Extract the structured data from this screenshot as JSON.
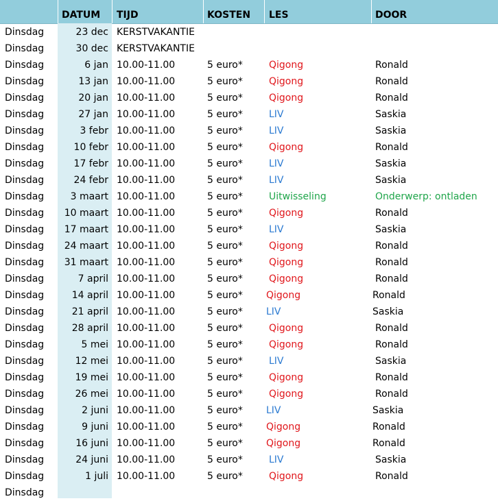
{
  "headers": {
    "col0": "",
    "datum": "DATUM",
    "tijd": "TIJD",
    "kosten": "KOSTEN",
    "les": "LES",
    "door": "DOOR"
  },
  "colors": {
    "header_bg": "#92cddc",
    "datum_bg": "#daeef3",
    "qigong": "#e0161b",
    "liv": "#2b7ad1",
    "uitwisseling": "#1fa54a"
  },
  "rows": [
    {
      "day": "Dinsdag",
      "date": "23 dec",
      "time": "KERSTVAKANTIE",
      "cost": "",
      "les": "",
      "les_type": "",
      "door": "",
      "door_type": ""
    },
    {
      "day": "Dinsdag",
      "date": "30 dec",
      "time": "KERSTVAKANTIE",
      "cost": "",
      "les": "",
      "les_type": "",
      "door": "",
      "door_type": ""
    },
    {
      "day": "Dinsdag",
      "date": "6 jan",
      "time": "10.00-11.00",
      "cost": "5 euro*",
      "les": "Qigong",
      "les_type": "qigong",
      "door": "Ronald",
      "door_type": ""
    },
    {
      "day": "Dinsdag",
      "date": "13 jan",
      "time": "10.00-11.00",
      "cost": "5 euro*",
      "les": "Qigong",
      "les_type": "qigong",
      "door": "Ronald",
      "door_type": ""
    },
    {
      "day": "Dinsdag",
      "date": "20 jan",
      "time": "10.00-11.00",
      "cost": "5 euro*",
      "les": "Qigong",
      "les_type": "qigong",
      "door": "Ronald",
      "door_type": ""
    },
    {
      "day": "Dinsdag",
      "date": "27 jan",
      "time": "10.00-11.00",
      "cost": "5 euro*",
      "les": "LIV",
      "les_type": "liv",
      "door": "Saskia",
      "door_type": ""
    },
    {
      "day": "Dinsdag",
      "date": "3 febr",
      "time": "10.00-11.00",
      "cost": "5 euro*",
      "les": "LIV",
      "les_type": "liv",
      "door": "Saskia",
      "door_type": ""
    },
    {
      "day": "Dinsdag",
      "date": "10 febr",
      "time": "10.00-11.00",
      "cost": "5 euro*",
      "les": "Qigong",
      "les_type": "qigong",
      "door": "Ronald",
      "door_type": ""
    },
    {
      "day": "Dinsdag",
      "date": "17 febr",
      "time": "10.00-11.00",
      "cost": "5 euro*",
      "les": "LIV",
      "les_type": "liv",
      "door": "Saskia",
      "door_type": ""
    },
    {
      "day": "Dinsdag",
      "date": "24 febr",
      "time": "10.00-11.00",
      "cost": "5 euro*",
      "les": "LIV",
      "les_type": "liv",
      "door": "Saskia",
      "door_type": ""
    },
    {
      "day": "Dinsdag",
      "date": "3 maart",
      "time": "10.00-11.00",
      "cost": "5 euro*",
      "les": "Uitwisseling",
      "les_type": "uitwisseling",
      "door": "Onderwerp:  ontladen",
      "door_type": "uitwisseling"
    },
    {
      "day": "Dinsdag",
      "date": "10 maart",
      "time": "10.00-11.00",
      "cost": "5 euro*",
      "les": "Qigong",
      "les_type": "qigong",
      "door": "Ronald",
      "door_type": ""
    },
    {
      "day": "Dinsdag",
      "date": "17 maart",
      "time": "10.00-11.00",
      "cost": "5 euro*",
      "les": "LIV",
      "les_type": "liv",
      "door": "Saskia",
      "door_type": ""
    },
    {
      "day": "Dinsdag",
      "date": "24 maart",
      "time": "10.00-11.00",
      "cost": "5 euro*",
      "les": "Qigong",
      "les_type": "qigong",
      "door": "Ronald",
      "door_type": ""
    },
    {
      "day": "Dinsdag",
      "date": "31 maart",
      "time": "10.00-11.00",
      "cost": "5 euro*",
      "les": "Qigong",
      "les_type": "qigong",
      "door": "Ronald",
      "door_type": ""
    },
    {
      "day": "Dinsdag",
      "date": "7 april",
      "time": "10.00-11.00",
      "cost": "5 euro*",
      "les": "Qigong",
      "les_type": "qigong",
      "door": "Ronald",
      "door_type": ""
    },
    {
      "day": "Dinsdag",
      "date": "14 april",
      "time": "10.00-11.00",
      "cost": "5 euro*",
      "les": "Qigong",
      "les_type": "qigong",
      "door": "Ronald",
      "door_type": ""
    },
    {
      "day": "Dinsdag",
      "date": "21 april",
      "time": "10.00-11.00",
      "cost": "5 euro*",
      "les": "LIV",
      "les_type": "liv",
      "door": "Saskia",
      "door_type": ""
    },
    {
      "day": "Dinsdag",
      "date": "28 april",
      "time": "10.00-11.00",
      "cost": "5 euro*",
      "les": "Qigong",
      "les_type": "qigong",
      "door": "Ronald",
      "door_type": ""
    },
    {
      "day": "Dinsdag",
      "date": "5 mei",
      "time": "10.00-11.00",
      "cost": "5 euro*",
      "les": "Qigong",
      "les_type": "qigong",
      "door": "Ronald",
      "door_type": ""
    },
    {
      "day": "Dinsdag",
      "date": "12 mei",
      "time": "10.00-11.00",
      "cost": "5 euro*",
      "les": "LIV",
      "les_type": "liv",
      "door": "Saskia",
      "door_type": ""
    },
    {
      "day": "Dinsdag",
      "date": "19 mei",
      "time": "10.00-11.00",
      "cost": "5 euro*",
      "les": "Qigong",
      "les_type": "qigong",
      "door": "Ronald",
      "door_type": ""
    },
    {
      "day": "Dinsdag",
      "date": "26 mei",
      "time": "10.00-11.00",
      "cost": "5 euro*",
      "les": "Qigong",
      "les_type": "qigong",
      "door": "Ronald",
      "door_type": ""
    },
    {
      "day": "Dinsdag",
      "date": "2 juni",
      "time": "10.00-11.00",
      "cost": "5 euro*",
      "les": "LIV",
      "les_type": "liv",
      "door": "Saskia",
      "door_type": ""
    },
    {
      "day": "Dinsdag",
      "date": "9 juni",
      "time": "10.00-11.00",
      "cost": "5 euro*",
      "les": "Qigong",
      "les_type": "qigong",
      "door": "Ronald",
      "door_type": ""
    },
    {
      "day": "Dinsdag",
      "date": "16 juni",
      "time": "10.00-11.00",
      "cost": "5 euro*",
      "les": "Qigong",
      "les_type": "qigong",
      "door": "Ronald",
      "door_type": ""
    },
    {
      "day": "Dinsdag",
      "date": "24 juni",
      "time": "10.00-11.00",
      "cost": "5 euro*",
      "les": "LIV",
      "les_type": "liv",
      "door": "Saskia",
      "door_type": ""
    },
    {
      "day": "Dinsdag",
      "date": "1 juli",
      "time": "10.00-11.00",
      "cost": "5 euro*",
      "les": "Qigong",
      "les_type": "qigong",
      "door": "Ronald",
      "door_type": ""
    },
    {
      "day": "Dinsdag",
      "date": "",
      "time": "",
      "cost": "",
      "les": "",
      "les_type": "",
      "door": "",
      "door_type": ""
    }
  ]
}
